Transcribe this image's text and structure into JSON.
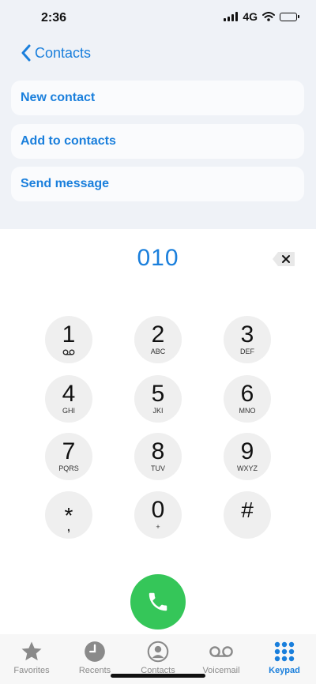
{
  "status_bar": {
    "time": "2:36",
    "network": "4G"
  },
  "header": {
    "back_label": "Contacts"
  },
  "actions": [
    {
      "label": "New contact"
    },
    {
      "label": "Add to contacts"
    },
    {
      "label": "Send message"
    }
  ],
  "dialer": {
    "number": "010"
  },
  "keypad": {
    "keys": [
      {
        "digit": "1",
        "letters": ""
      },
      {
        "digit": "2",
        "letters": "ABC"
      },
      {
        "digit": "3",
        "letters": "DEF"
      },
      {
        "digit": "4",
        "letters": "GHI"
      },
      {
        "digit": "5",
        "letters": "JKI"
      },
      {
        "digit": "6",
        "letters": "MNO"
      },
      {
        "digit": "7",
        "letters": "PQRS"
      },
      {
        "digit": "8",
        "letters": "TUV"
      },
      {
        "digit": "9",
        "letters": "WXYZ"
      },
      {
        "digit": "*",
        "letters": ","
      },
      {
        "digit": "0",
        "letters": "+"
      },
      {
        "digit": "#",
        "letters": ""
      }
    ]
  },
  "tabs": [
    {
      "label": "Favorites",
      "icon": "star-icon"
    },
    {
      "label": "Recents",
      "icon": "clock-icon"
    },
    {
      "label": "Contacts",
      "icon": "person-icon"
    },
    {
      "label": "Voicemail",
      "icon": "voicemail-icon"
    },
    {
      "label": "Keypad",
      "icon": "keypad-icon",
      "active": true
    }
  ],
  "colors": {
    "accent": "#1a7fdc",
    "call_green": "#35c659",
    "header_bg": "#eff2f7",
    "key_bg": "#efefef",
    "tab_inactive": "#8a8a8a"
  }
}
